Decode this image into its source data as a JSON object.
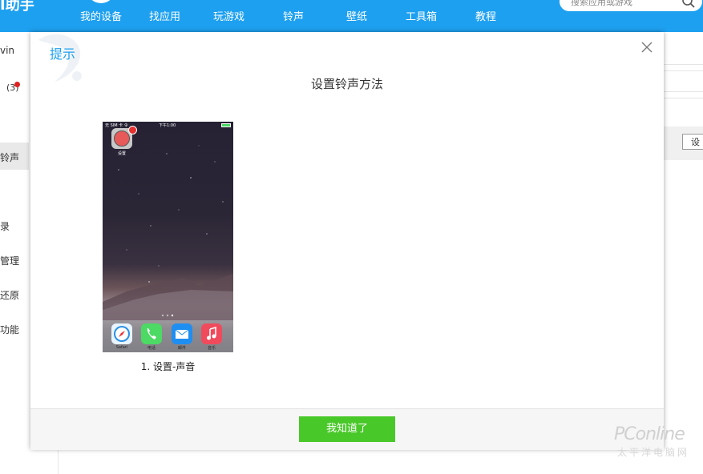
{
  "header": {
    "brand": "I助手",
    "nav": [
      "我的设备",
      "找应用",
      "玩游戏",
      "铃声",
      "壁纸",
      "工具箱",
      "教程"
    ],
    "search_placeholder": "搜索应用或游戏"
  },
  "sidebar": {
    "items": [
      "vin",
      "(3)",
      "铃声",
      "录",
      "管理",
      "还原",
      "功能"
    ]
  },
  "background": {
    "right_button": "设"
  },
  "dialog": {
    "title": "提示",
    "subtitle": "设置铃声方法",
    "phone": {
      "carrier": "无 SIM 卡 令",
      "time": "下午1:00",
      "settings_label": "设置",
      "dock": [
        "Safari",
        "电话",
        "邮件",
        "音乐"
      ]
    },
    "step_label": "1. 设置-声音",
    "ok_button": "我知道了"
  },
  "watermark": {
    "main": "PConline",
    "sub": "太平洋电脑网"
  },
  "colors": {
    "nav_blue": "#1ea0f0",
    "ok_green": "#49c829"
  }
}
